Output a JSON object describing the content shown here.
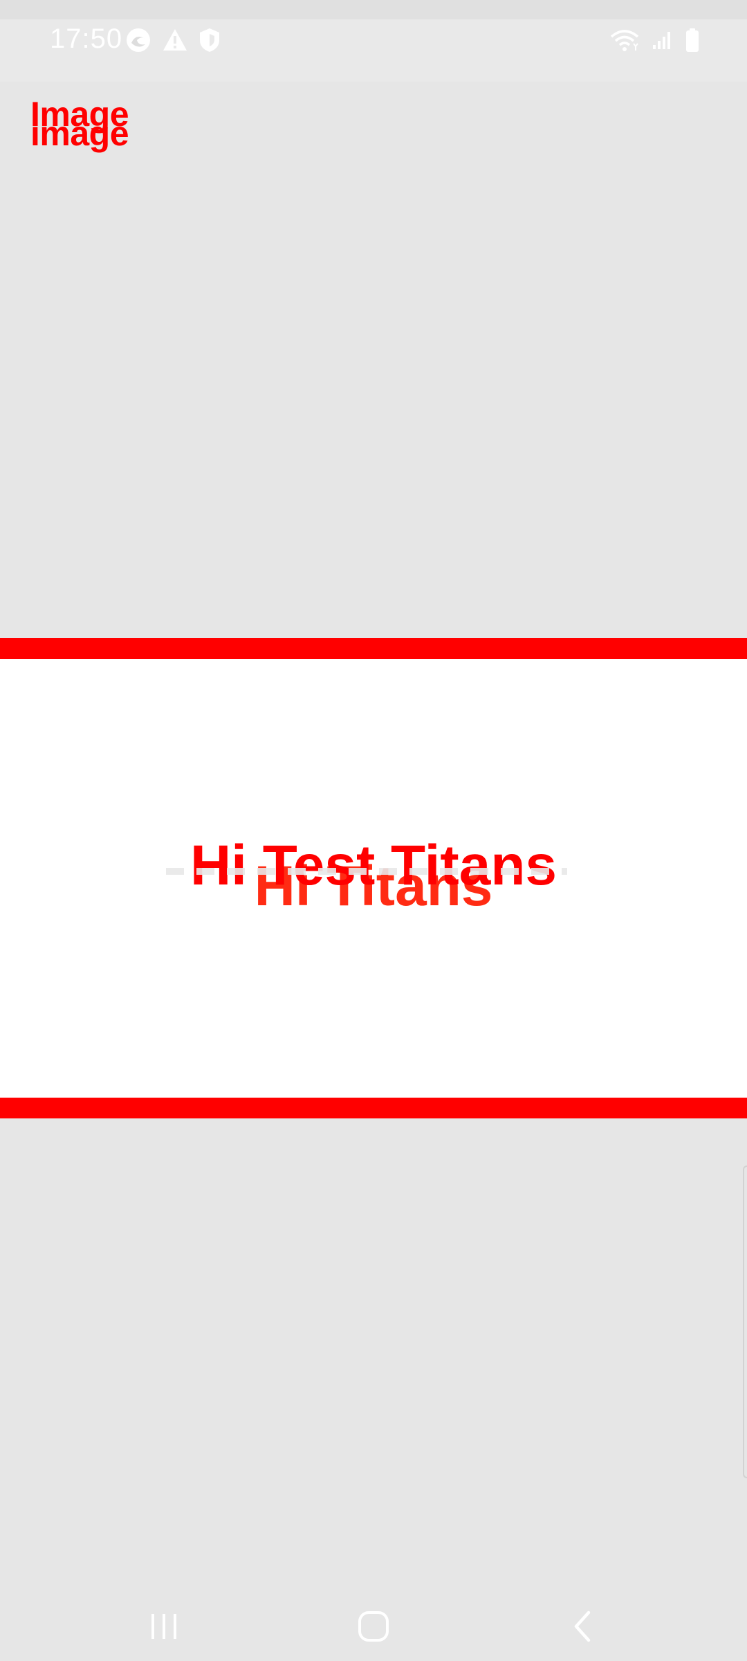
{
  "status_bar": {
    "time": "17:50",
    "left_icons": [
      "edge-browser-icon",
      "warning-icon",
      "shield-icon"
    ],
    "right_icons": [
      "wifi-icon",
      "signal-icon",
      "battery-icon"
    ]
  },
  "app": {
    "logo_line_1": "Image",
    "logo_line_2": "image"
  },
  "banner": {
    "text": "Hi Test Titans",
    "ghost_text": "Hi Titans",
    "accent_color": "#ff0000"
  },
  "nav_bar": {
    "buttons": [
      "recents-icon",
      "home-icon",
      "back-icon"
    ]
  }
}
